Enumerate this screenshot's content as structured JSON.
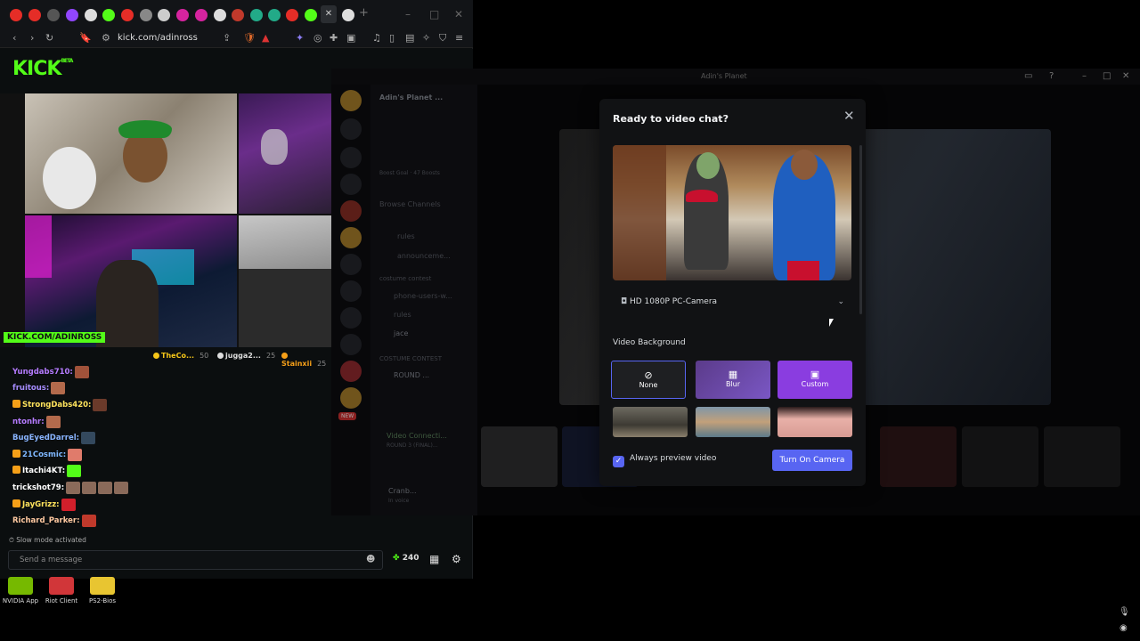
{
  "browser": {
    "url": "kick.com/adinross",
    "win_controls": {
      "minimize": "–",
      "maximize": "□",
      "close": "✕"
    }
  },
  "kick": {
    "logo": "KICK",
    "logo_tag": "BETA",
    "stream_banner": "KICK.COM/ADINROSS",
    "viewers": [
      {
        "name": "TheCo...",
        "count": "50",
        "color": "#f5c518"
      },
      {
        "name": "jugga2...",
        "count": "25",
        "color": "#dddddd"
      },
      {
        "name": "Stainxii",
        "count": "25",
        "color": "#f59f18"
      }
    ],
    "chat": [
      {
        "user": "Yungdabs710:",
        "color": "#b57bff",
        "badge": false,
        "emotes": [
          "#a0523a"
        ]
      },
      {
        "user": "fruitous:",
        "color": "#a68cff",
        "badge": false,
        "emotes": [
          "#b36a4c"
        ]
      },
      {
        "user": "StrongDabs420:",
        "color": "#ffe35c",
        "badge": true,
        "emotes": [
          "#6b3a2a"
        ]
      },
      {
        "user": "ntonhr:",
        "color": "#b57bff",
        "badge": false,
        "emotes": [
          "#b36a4c"
        ]
      },
      {
        "user": "BugEyedDarrel:",
        "color": "#89b4ff",
        "badge": false,
        "emotes": [
          "#34495e"
        ]
      },
      {
        "user": "21Cosmic:",
        "color": "#7fb8ff",
        "badge": true,
        "emotes": [
          "#e07b6b"
        ]
      },
      {
        "user": "Itachi4KT:",
        "color": "#ffffff",
        "badge": true,
        "emotes": [
          "#53fc18"
        ]
      },
      {
        "user": "trickshot79:",
        "color": "#ffffff",
        "badge": false,
        "emotes": [
          "#8a6a5a",
          "#8a6a5a",
          "#8a6a5a",
          "#8a6a5a"
        ]
      },
      {
        "user": "JayGrizz:",
        "color": "#ffe35c",
        "badge": true,
        "emotes": [
          "#d21f2b"
        ]
      },
      {
        "user": "Richard_Parker:",
        "color": "#ffc9a1",
        "badge": false,
        "emotes": [
          "#c0392b"
        ]
      }
    ],
    "slow_mode": "Slow mode activated",
    "input_placeholder": "Send a message",
    "points": "240"
  },
  "desktop_icons": [
    {
      "label": "NVIDIA App",
      "color": "#76b900"
    },
    {
      "label": "Riot Client",
      "color": "#d13639"
    },
    {
      "label": "PS2-Bios",
      "color": "#e8c531"
    }
  ],
  "discord": {
    "window_title": "Adin's Planet",
    "server_name": "Adin's Planet ...",
    "boost_goal": "Boost Goal",
    "boosts": "47 Boosts",
    "channels": [
      "Browse Channels",
      "rules",
      "announceme...",
      "costume contest",
      "phone-users-w...",
      "rules",
      "jace",
      "COSTUME CONTEST",
      "ROUND ..."
    ],
    "voice_status": "Video Connecti...",
    "voice_sub": "ROUND 3 (FINAL)...",
    "user_name": "Cranb...",
    "user_status": "In voice",
    "new_badge": "NEW"
  },
  "modal": {
    "title": "Ready to video chat?",
    "camera": "HD 1080P PC-Camera",
    "bg_section": "Video Background",
    "bg_options": [
      {
        "label": "None",
        "icon": "⊘"
      },
      {
        "label": "Blur",
        "icon": "▦"
      },
      {
        "label": "Custom",
        "icon": "▣"
      }
    ],
    "always_preview": "Always preview video",
    "turn_on": "Turn On Camera"
  }
}
